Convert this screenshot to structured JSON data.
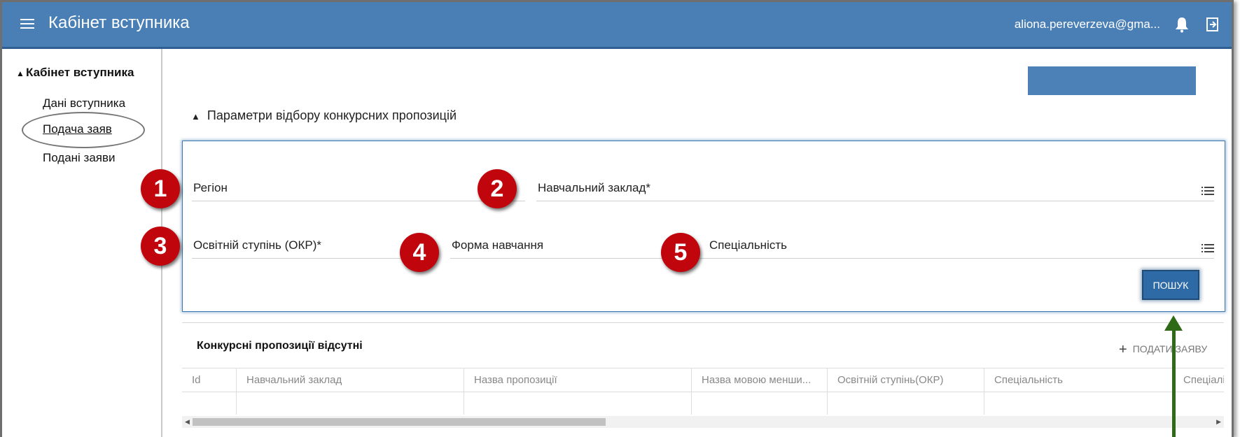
{
  "header": {
    "title": "Кабінет вступника",
    "user_email": "aliona.pereverzeva@gma...",
    "menu_icon": "hamburger-menu-icon",
    "bell_icon": "bell-icon",
    "logout_icon": "logout-icon",
    "bg_color": "#4a7fb6"
  },
  "sidebar": {
    "heading": "Кабінет вступника",
    "items": [
      {
        "label": "Дані вступника"
      },
      {
        "label": "Подача заяв",
        "active": true
      },
      {
        "label": "Подані заяви"
      }
    ]
  },
  "main": {
    "params_header": "Параметри відбору конкурсних пропозицій",
    "fields": {
      "region": "Регіон",
      "school": "Навчальний заклад*",
      "degree": "Освітній ступінь (ОКР)*",
      "form": "Форма навчання",
      "specialty": "Спеціальність"
    },
    "search_button": "ПОШУК",
    "badges": [
      "1",
      "2",
      "3",
      "4",
      "5"
    ],
    "table_title": "Конкурсні пропозиції відсутні",
    "submit_link": "ПОДАТИ ЗАЯВУ",
    "columns": [
      "Id",
      "Навчальний заклад",
      "Назва пропозиції",
      "Назва мовою менши...",
      "Освітній ступінь(ОКР)",
      "Спеціальність",
      "Спеціалізація"
    ],
    "accent_color": "#2d6aa6",
    "badge_color": "#c0050d",
    "arrow_color": "#2f6a16"
  }
}
